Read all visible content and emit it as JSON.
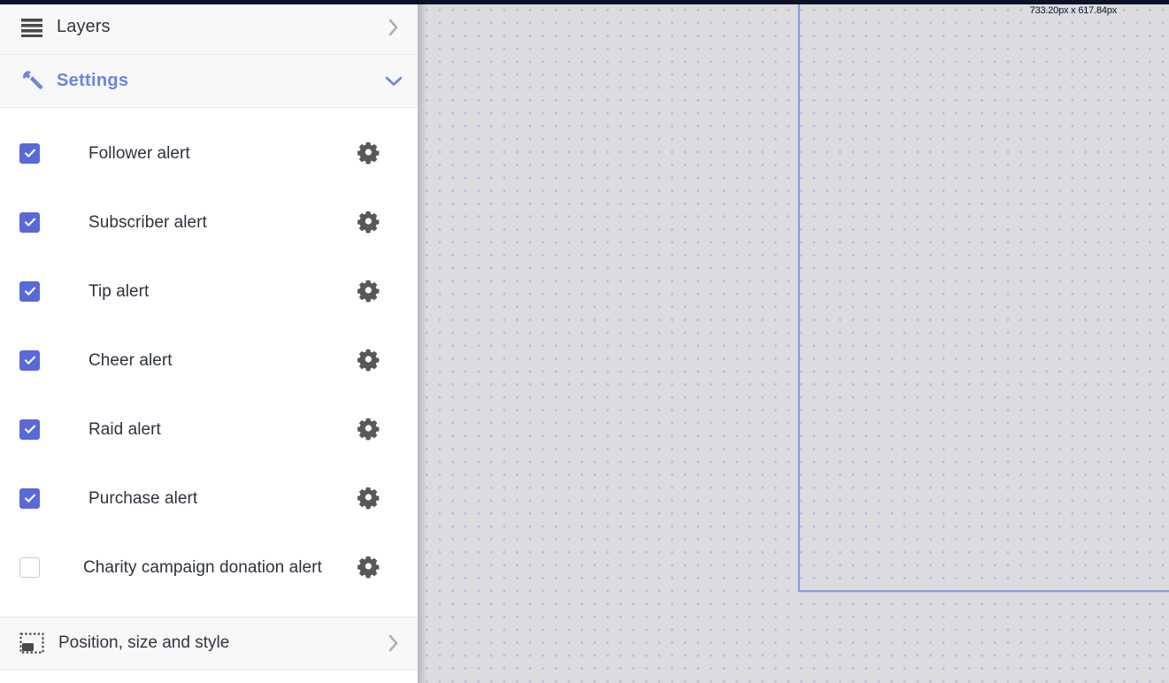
{
  "window": {
    "top_bar_color": "#0d1228",
    "accent_color": "#5a69d8",
    "panel_header_bg": "#f8f8f9"
  },
  "sidebar": {
    "panels": [
      {
        "label": "Layers",
        "icon": "layers-stack-icon",
        "chevron": "chevron-right-icon",
        "expanded": false
      },
      {
        "label": "Settings",
        "icon": "wrench-icon",
        "chevron": "chevron-down-icon",
        "expanded": true
      }
    ],
    "alerts": [
      {
        "label": "Follower alert",
        "checked": true,
        "gear": "gear-icon"
      },
      {
        "label": "Subscriber alert",
        "checked": true,
        "gear": "gear-icon"
      },
      {
        "label": "Tip alert",
        "checked": true,
        "gear": "gear-icon"
      },
      {
        "label": "Cheer alert",
        "checked": true,
        "gear": "gear-icon"
      },
      {
        "label": "Raid alert",
        "checked": true,
        "gear": "gear-icon"
      },
      {
        "label": "Purchase alert",
        "checked": true,
        "gear": "gear-icon"
      },
      {
        "label": "Charity campaign donation alert",
        "checked": false,
        "gear": "gear-icon"
      }
    ],
    "footer": {
      "label": "Position, size and style",
      "icon": "position-size-icon",
      "chevron": "chevron-right-icon"
    }
  },
  "canvas": {
    "dimension_label": "733.20px x 617.84px",
    "background_color": "#dcdcdf",
    "dot_color": "#b9bedd",
    "selection_border_color": "#8b9ddc"
  }
}
